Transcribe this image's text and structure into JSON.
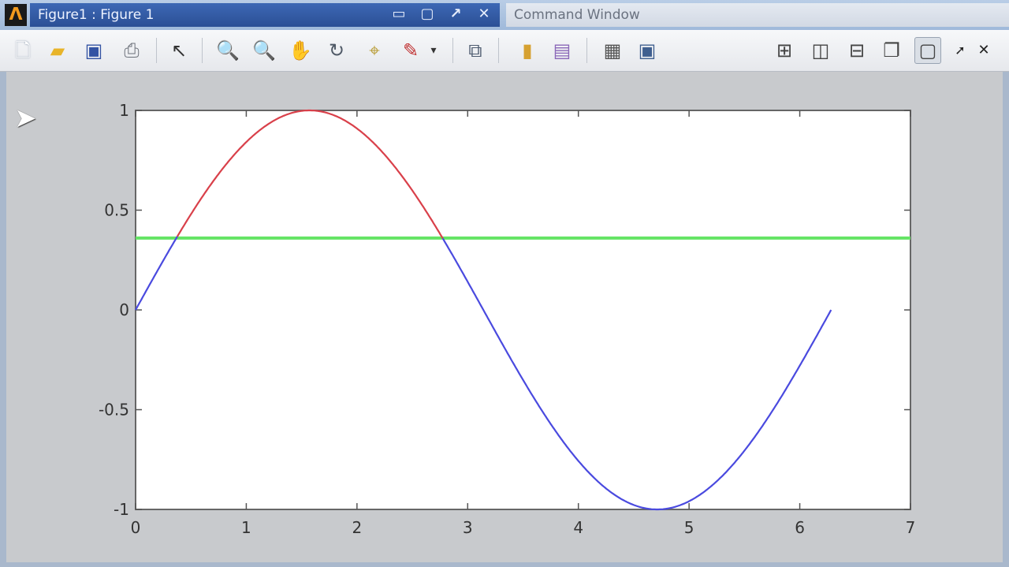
{
  "window": {
    "figure_title": "Figure1 : Figure 1",
    "command_window_title": "Command Window",
    "app_icon": "matlab-logo-icon"
  },
  "toolbar": {
    "icons": [
      "new-figure-icon",
      "open-file-icon",
      "save-icon",
      "print-icon",
      "edit-plot-arrow-icon",
      "zoom-in-icon",
      "zoom-out-icon",
      "pan-icon",
      "rotate-3d-icon",
      "data-cursor-icon",
      "brush-icon",
      "brush-dropdown-icon",
      "link-plot-icon",
      "insert-colorbar-icon",
      "insert-legend-icon",
      "hide-plot-tools-icon",
      "show-plot-tools-icon",
      "tile-grid-icon",
      "tile-columns-icon",
      "tile-rows-icon",
      "float-icon",
      "dock-icon",
      "undock-arrow-icon",
      "close-icon"
    ]
  },
  "colors": {
    "sine_red": "#d9404a",
    "sine_blue": "#4a4adf",
    "threshold_green": "#64e464",
    "axes_bg": "#ffffff"
  },
  "chart_data": {
    "type": "line",
    "xlim": [
      0,
      7
    ],
    "ylim": [
      -1,
      1
    ],
    "xticks": [
      0,
      1,
      2,
      3,
      4,
      5,
      6,
      7
    ],
    "yticks": [
      -1,
      -0.5,
      0,
      0.5,
      1
    ],
    "xtick_labels": [
      "0",
      "1",
      "2",
      "3",
      "4",
      "5",
      "6",
      "7"
    ],
    "ytick_labels": [
      "-1",
      "-0.5",
      "0",
      "0.5",
      "1"
    ],
    "grid": false,
    "series": [
      {
        "function": "sin(x)",
        "x_range": [
          0,
          6.283
        ],
        "color_above_threshold": "#d9404a",
        "color_below_threshold": "#4a4adf"
      },
      {
        "function": "constant",
        "y": 0.36,
        "x_range": [
          0,
          7
        ],
        "color": "#64e464"
      }
    ],
    "threshold": 0.36
  }
}
